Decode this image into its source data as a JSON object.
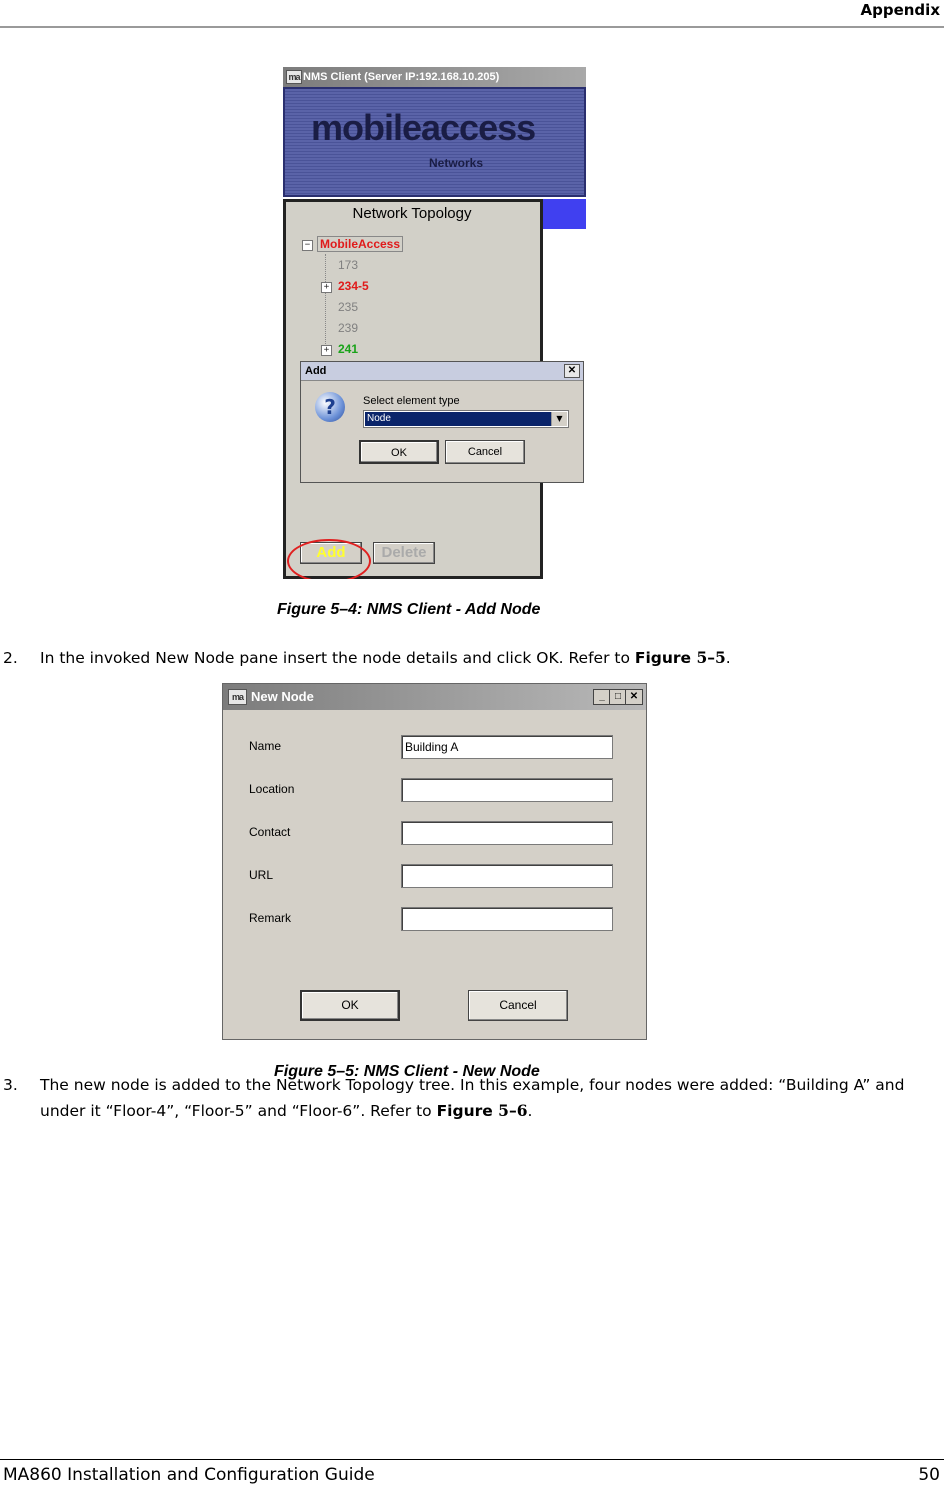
{
  "header": {
    "title": "Appendix"
  },
  "figure1": {
    "window_title": "NMS Client  (Server IP:192.168.10.205)",
    "app_icon": "ma",
    "banner": {
      "logo_main": "mobileaccess",
      "logo_sub": "Networks"
    },
    "panel_title": "Network Topology",
    "tree": {
      "root": "MobileAccess",
      "items": [
        {
          "label": "173",
          "color": "#808080"
        },
        {
          "label": "234-5",
          "color": "#e01b1b"
        },
        {
          "label": "235",
          "color": "#808080"
        },
        {
          "label": "239",
          "color": "#808080"
        },
        {
          "label": "241",
          "color": "#19a319"
        }
      ]
    },
    "dialog": {
      "title": "Add",
      "prompt": "Select element type",
      "selected": "Node",
      "ok": "OK",
      "cancel": "Cancel"
    },
    "buttons": {
      "add": "Add",
      "delete": "Delete"
    },
    "highlight_color": "#e02020"
  },
  "caption1": "Figure 5–4: NMS Client - Add Node",
  "step2": {
    "num": "2.",
    "text": "In the invoked New Node pane insert the node details and click OK.  Refer to ",
    "ref_word": "Figure ",
    "ref_num": "5–5",
    "end": "."
  },
  "figure2": {
    "window_title": "New Node",
    "app_icon": "ma",
    "fields": [
      {
        "label": "Name",
        "value": "Building A"
      },
      {
        "label": "Location",
        "value": ""
      },
      {
        "label": "Contact",
        "value": ""
      },
      {
        "label": "URL",
        "value": ""
      },
      {
        "label": "Remark",
        "value": ""
      }
    ],
    "ok": "OK",
    "cancel": "Cancel"
  },
  "caption2": "Figure 5–5: NMS Client - New Node",
  "step3": {
    "num": "3.",
    "text": "The new node is added to the Network Topology tree. In this example, four nodes were added: “Building A” and under it “Floor-4”, “Floor-5” and “Floor-6”.  Refer to ",
    "ref_word": "Figure ",
    "ref_num": "5–6",
    "end": "."
  },
  "footer": {
    "left": "MA860 Installation and Configuration Guide",
    "page": "50"
  }
}
